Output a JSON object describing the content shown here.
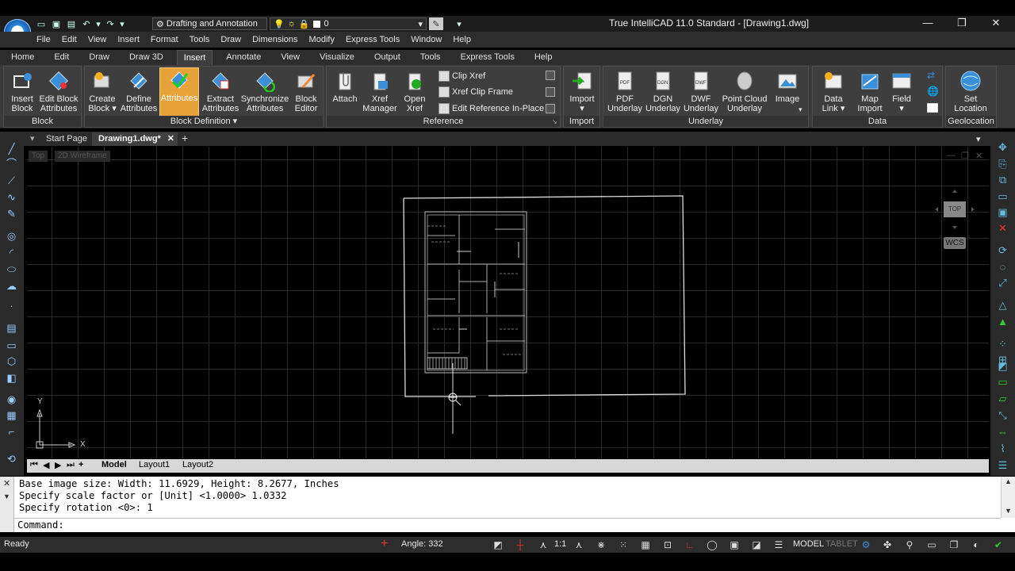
{
  "title_bar": {
    "workspace": "Drafting and Annotation",
    "layer": "0",
    "app_title": "True IntelliCAD 11.0 Standard - [Drawing1.dwg]"
  },
  "menu": [
    "File",
    "Edit",
    "View",
    "Insert",
    "Format",
    "Tools",
    "Draw",
    "Dimensions",
    "Modify",
    "Express Tools",
    "Window",
    "Help"
  ],
  "ribbon_tabs": [
    "Home",
    "Edit",
    "Draw",
    "Draw 3D",
    "Insert",
    "Annotate",
    "View",
    "Visualize",
    "Output",
    "Tools",
    "Express Tools",
    "Help"
  ],
  "ribbon": {
    "block": {
      "label": "Block",
      "insert": "Insert\nBlock",
      "edit_attr": "Edit Block\nAttributes"
    },
    "block_def": {
      "label": "Block Definition ▾",
      "create": "Create\nBlock ▾",
      "define": "Define\nAttributes",
      "attributes": "Attributes",
      "extract": "Extract\nAttributes",
      "sync": "Synchronize\nAttributes",
      "editor": "Block\nEditor"
    },
    "reference": {
      "label": "Reference",
      "attach": "Attach",
      "xref_manager": "Xref\nManager",
      "open_xref": "Open\nXref",
      "clip_xref": "Clip Xref",
      "xref_clip_frame": "Xref Clip Frame",
      "edit_ref": "Edit Reference In-Place"
    },
    "import": {
      "label": "Import",
      "import": "Import\n▾"
    },
    "underlay": {
      "label": "Underlay",
      "pdf": "PDF\nUnderlay",
      "dgn": "DGN\nUnderlay",
      "dwf": "DWF\nUnderlay",
      "point_cloud": "Point Cloud\nUnderlay",
      "image": "Image"
    },
    "data": {
      "label": "Data",
      "data_link": "Data\nLink ▾",
      "map_import": "Map\nImport",
      "field": "Field\n▾"
    },
    "geolocation": {
      "label": "Geolocation",
      "set_location": "Set\nLocation"
    }
  },
  "doc_tabs": {
    "start": "Start Page",
    "drawing": "Drawing1.dwg*"
  },
  "viewport": {
    "view": "Top",
    "style": "2D Wireframe",
    "cube_label": "TOP",
    "wcs": "WCS",
    "axis_x": "X",
    "axis_y": "Y"
  },
  "layout_tabs": [
    "Model",
    "Layout1",
    "Layout2"
  ],
  "command": {
    "lines": [
      "Base image size: Width: 11.6929, Height: 8.2677, Inches",
      "Specify scale factor or [Unit] <1.0000> 1.0332",
      "Specify rotation <0>: 1"
    ],
    "prompt": "Command:"
  },
  "status": {
    "ready": "Ready",
    "angle": "Angle: 332",
    "scale": "1:1",
    "model": "MODEL",
    "tablet": "TABLET"
  }
}
